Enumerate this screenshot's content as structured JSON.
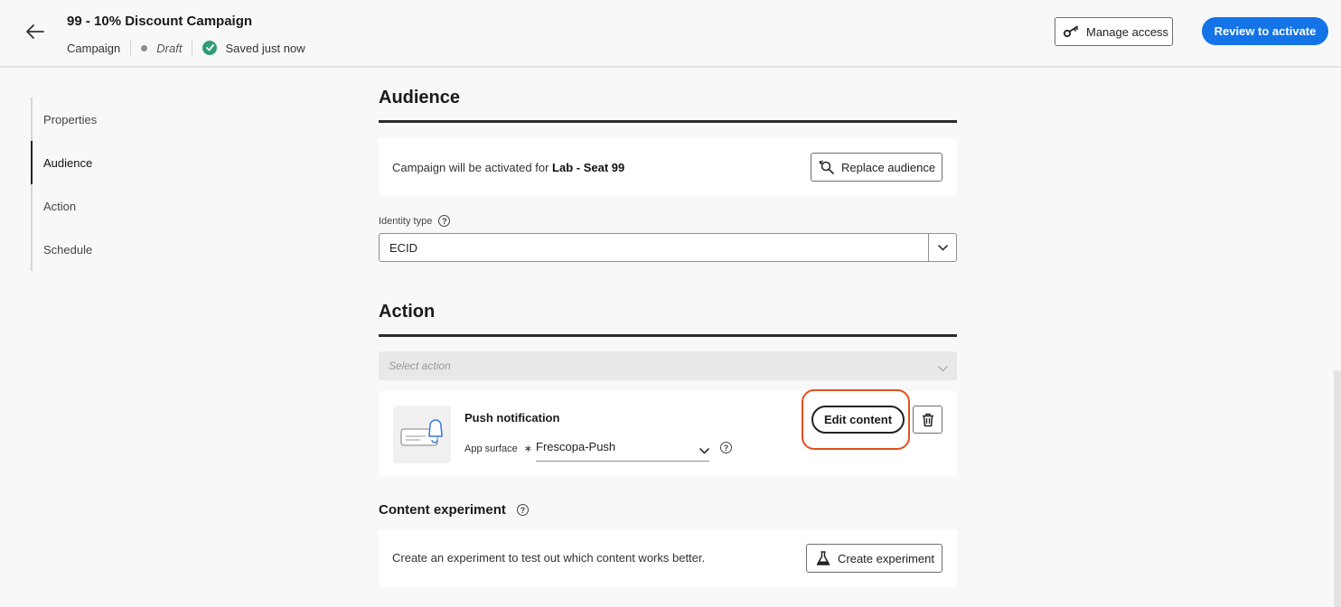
{
  "header": {
    "title": "99 - 10% Discount Campaign",
    "type": "Campaign",
    "status": "Draft",
    "saved": "Saved just now",
    "manage_access": "Manage access",
    "review": "Review to activate"
  },
  "sidenav": {
    "items": [
      {
        "label": "Properties",
        "active": false
      },
      {
        "label": "Audience",
        "active": true
      },
      {
        "label": "Action",
        "active": false
      },
      {
        "label": "Schedule",
        "active": false
      }
    ]
  },
  "audience": {
    "heading": "Audience",
    "activated_prefix": "Campaign will be activated for",
    "audience_name": "Lab - Seat 99",
    "replace_button": "Replace audience",
    "identity_label": "Identity type",
    "identity_value": "ECID"
  },
  "action": {
    "heading": "Action",
    "select_placeholder": "Select action",
    "push_title": "Push notification",
    "app_surface_label": "App surface",
    "app_surface_value": "Frescopa-Push",
    "edit_button": "Edit content"
  },
  "experiment": {
    "heading": "Content experiment",
    "description": "Create an experiment to test out which content works better.",
    "create_button": "Create experiment"
  },
  "colors": {
    "accent": "#1473e6",
    "success": "#2d9d78",
    "highlight": "#e34f1e"
  }
}
